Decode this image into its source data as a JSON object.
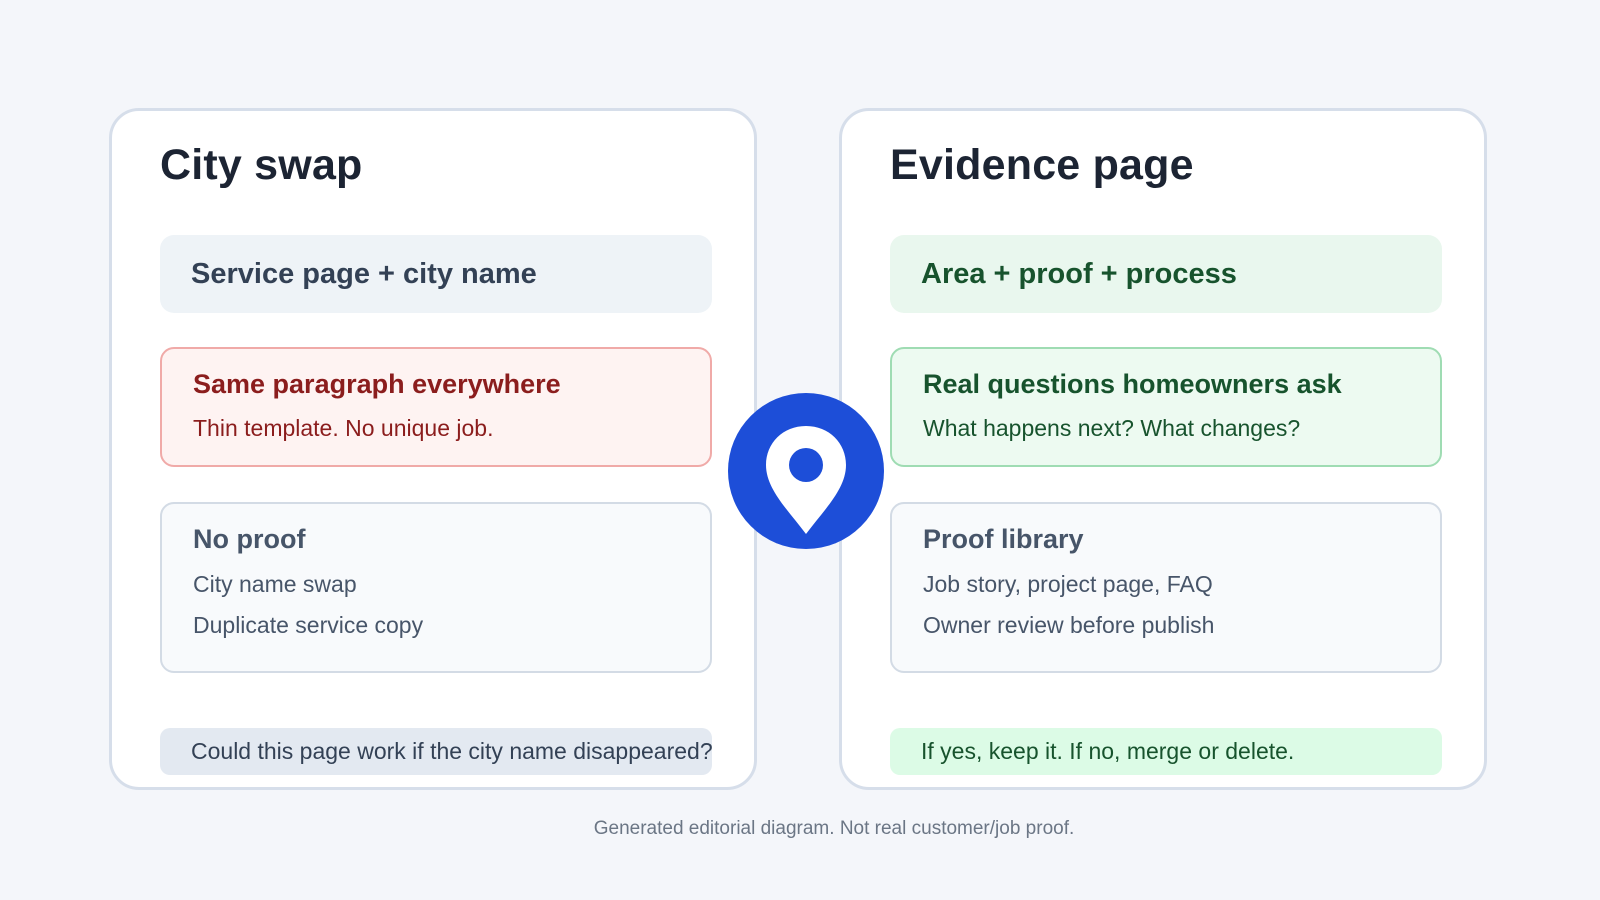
{
  "left_panel": {
    "title": "City swap",
    "head": "Service page + city name",
    "warning": {
      "title": "Same paragraph everywhere",
      "text": "Thin template. No unique job."
    },
    "list": {
      "title": "No proof",
      "items": [
        "City name swap",
        "Duplicate service copy"
      ]
    },
    "footer": "Could this page work if the city name disappeared?"
  },
  "right_panel": {
    "title": "Evidence page",
    "head": "Area + proof + process",
    "highlight": {
      "title": "Real questions homeowners ask",
      "text": "What happens next? What changes?"
    },
    "list": {
      "title": "Proof library",
      "items": [
        "Job story, project page, FAQ",
        "Owner review before publish"
      ]
    },
    "footer": "If yes, keep it. If no, merge or delete."
  },
  "center_icon": "location-pin-icon",
  "caption": "Generated editorial diagram. Not real customer/job proof.",
  "colors": {
    "accent": "#1d4ed8",
    "negative": "#8b1d1d",
    "positive": "#17532d"
  }
}
